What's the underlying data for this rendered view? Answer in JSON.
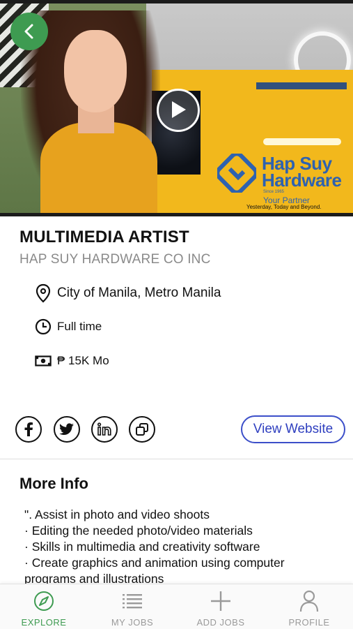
{
  "hero": {
    "screen_logo_line1": "Hap Suy",
    "screen_logo_line2": "Hardware",
    "screen_logo_since": "Since 1965",
    "screen_partner": "Your Partner",
    "screen_tagline": "Yesterday, Today and Beyond."
  },
  "job": {
    "title": "MULTIMEDIA ARTIST",
    "company": "HAP SUY HARDWARE CO INC",
    "location": "City of Manila, Metro Manila",
    "employment_type": "Full time",
    "salary": "₱ 15K Mo"
  },
  "actions": {
    "view_website": "View Website"
  },
  "more_info": {
    "title": "More Info",
    "lines": [
      "\". Assist in photo and video shoots",
      "· Editing the needed photo/video materials",
      "· Skills in multimedia and creativity software",
      "· Create graphics and animation using computer",
      "programs and illustrations"
    ]
  },
  "bottom_nav": {
    "items": [
      {
        "label": "EXPLORE",
        "icon": "compass-icon",
        "active": true
      },
      {
        "label": "MY JOBS",
        "icon": "list-icon",
        "active": false
      },
      {
        "label": "ADD JOBS",
        "icon": "plus-icon",
        "active": false
      },
      {
        "label": "PROFILE",
        "icon": "person-icon",
        "active": false
      }
    ]
  },
  "colors": {
    "accent_green": "#3e9b51",
    "link_blue": "#2f3fbf",
    "muted_gray": "#8a8a8a"
  }
}
